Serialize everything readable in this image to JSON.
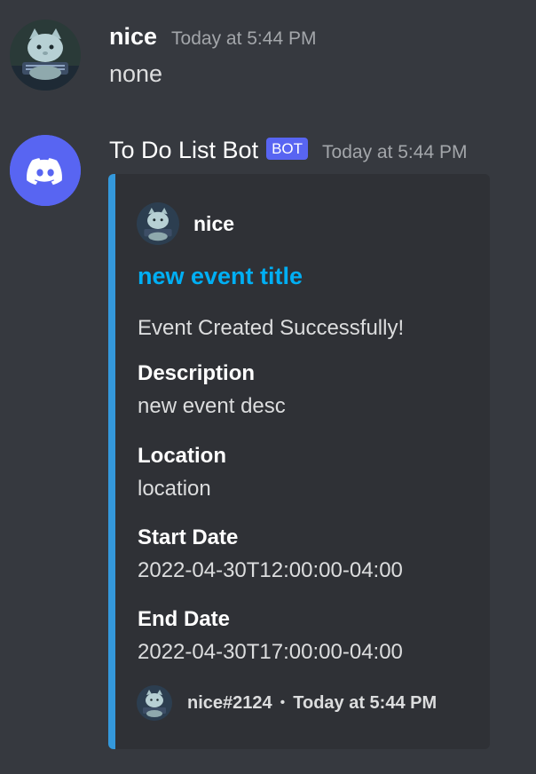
{
  "messages": [
    {
      "username": "nice",
      "timestamp": "Today at 5:44 PM",
      "content": "none",
      "avatar_icon": "cat-avatar-icon"
    },
    {
      "username": "To Do List Bot",
      "bot_tag": "BOT",
      "timestamp": "Today at 5:44 PM",
      "avatar_icon": "discord-logo-icon",
      "embed": {
        "accent_color": "#3498db",
        "author": {
          "name": "nice",
          "icon": "cat-avatar-icon"
        },
        "title": "new event title",
        "description": "Event Created Successfully!",
        "fields": [
          {
            "name": "Description",
            "value": "new event desc"
          },
          {
            "name": "Location",
            "value": "location"
          },
          {
            "name": "Start Date",
            "value": "2022-04-30T12:00:00-04:00"
          },
          {
            "name": "End Date",
            "value": "2022-04-30T17:00:00-04:00"
          }
        ],
        "footer": {
          "text": "nice#2124",
          "separator": "•",
          "timestamp": "Today at 5:44 PM",
          "icon": "cat-avatar-icon"
        }
      }
    }
  ],
  "colors": {
    "background": "#36393f",
    "embed_background": "#2f3136",
    "link": "#00aff4",
    "blurple": "#5865f2",
    "muted": "#a3a6aa"
  }
}
